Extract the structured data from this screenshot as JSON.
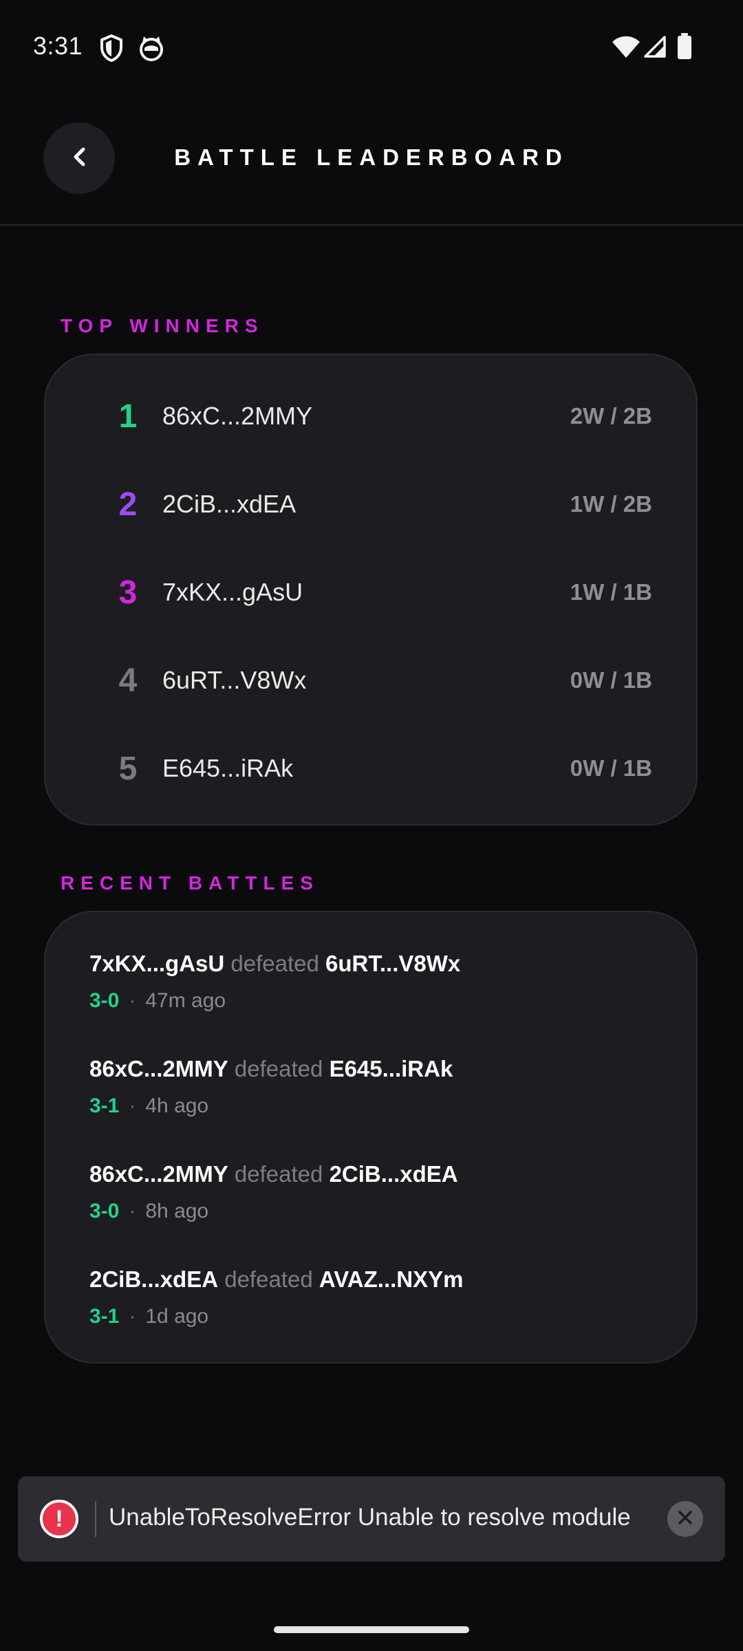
{
  "status_bar": {
    "time": "3:31",
    "left_icons": [
      "shield-icon",
      "cat-face-icon"
    ],
    "right_icons": [
      "wifi-icon",
      "signal-icon",
      "battery-icon"
    ]
  },
  "header": {
    "back_label": "‹",
    "title": "BATTLE LEADERBOARD"
  },
  "top_winners": {
    "label": "TOP WINNERS",
    "entries": [
      {
        "rank": "1",
        "name": "86xC...2MMY",
        "stats": "2W / 2B",
        "color": "#22d38a"
      },
      {
        "rank": "2",
        "name": "2CiB...xdEA",
        "stats": "1W / 2B",
        "color": "#9b4ff0"
      },
      {
        "rank": "3",
        "name": "7xKX...gAsU",
        "stats": "1W / 1B",
        "color": "#d426e0"
      },
      {
        "rank": "4",
        "name": "6uRT...V8Wx",
        "stats": "0W / 1B",
        "color": "#7a7a80"
      },
      {
        "rank": "5",
        "name": "E645...iRAk",
        "stats": "0W / 1B",
        "color": "#7a7a80"
      }
    ]
  },
  "recent_battles": {
    "label": "RECENT BATTLES",
    "verb": "defeated",
    "separator": "·",
    "items": [
      {
        "winner": "7xKX...gAsU",
        "loser": "6uRT...V8Wx",
        "score": "3-0",
        "time": "47m ago"
      },
      {
        "winner": "86xC...2MMY",
        "loser": "E645...iRAk",
        "score": "3-1",
        "time": "4h ago"
      },
      {
        "winner": "86xC...2MMY",
        "loser": "2CiB...xdEA",
        "score": "3-0",
        "time": "8h ago"
      },
      {
        "winner": "2CiB...xdEA",
        "loser": "AVAZ...NXYm",
        "score": "3-1",
        "time": "1d ago"
      }
    ]
  },
  "toast": {
    "icon_glyph": "!",
    "message": "UnableToResolveError Unable to resolve module"
  },
  "colors": {
    "accent_magenta": "#d426e0",
    "score_green": "#22d38a",
    "background": "#0b0b0e",
    "card": "#1d1d21",
    "error": "#e8334d"
  }
}
